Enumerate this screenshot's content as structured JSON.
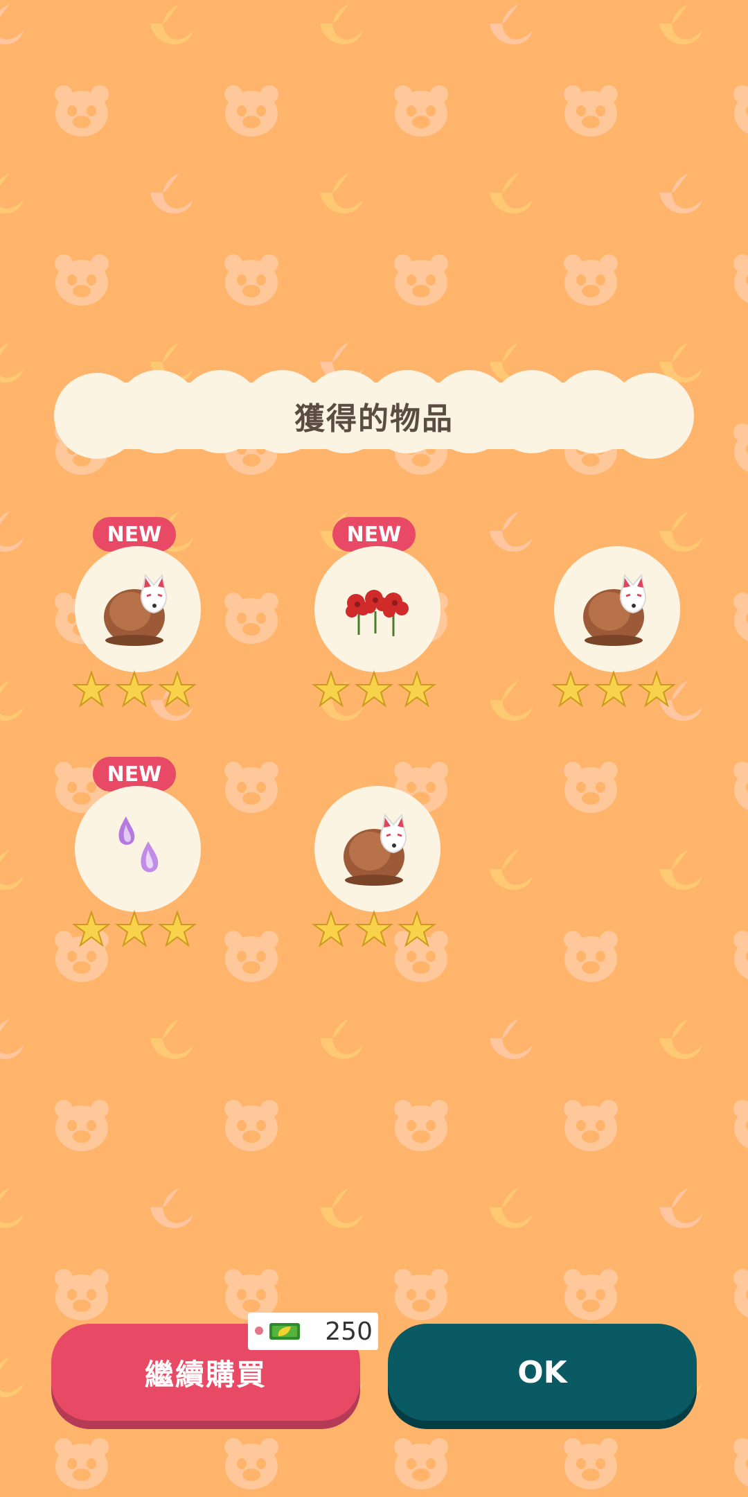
{
  "screen": {
    "title": "獲得的物品",
    "background_color": "#ffb46c"
  },
  "items": [
    {
      "id": "fox-mask-boulder-1",
      "icon": "fox-mask-boulder-icon",
      "is_new": true,
      "badge": "NEW",
      "stars": 3
    },
    {
      "id": "red-spider-lily",
      "icon": "red-spider-lily-icon",
      "is_new": true,
      "badge": "NEW",
      "stars": 3
    },
    {
      "id": "fox-mask-boulder-2",
      "icon": "fox-mask-boulder-icon",
      "is_new": false,
      "badge": "",
      "stars": 3
    },
    {
      "id": "will-o-wisp",
      "icon": "will-o-wisp-icon",
      "is_new": true,
      "badge": "NEW",
      "stars": 3
    },
    {
      "id": "fox-mask-boulder-3",
      "icon": "fox-mask-boulder-icon",
      "is_new": false,
      "badge": "",
      "stars": 3
    }
  ],
  "buttons": {
    "continue_label": "繼續購買",
    "continue_color": "#e84a65",
    "ok_label": "OK",
    "ok_color": "#0a5a64"
  },
  "price": {
    "currency_icon": "leaf-ticket-icon",
    "value": "250"
  }
}
